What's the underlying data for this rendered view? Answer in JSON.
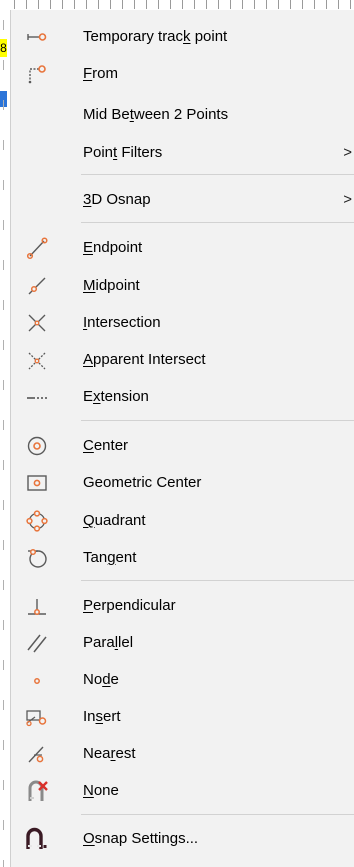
{
  "menu": {
    "items": [
      {
        "id": "temp-track",
        "pre": "Temporary trac",
        "mn": "k",
        "post": " point",
        "icon": "temporary-track-point-icon"
      },
      {
        "id": "from",
        "pre": "",
        "mn": "F",
        "post": "rom",
        "icon": "from-icon"
      },
      {
        "id": "mid-between",
        "pre": "Mid Be",
        "mn": "t",
        "post": "ween 2 Points",
        "icon": ""
      },
      {
        "id": "point-filters",
        "pre": "Poin",
        "mn": "t",
        "post": " Filters",
        "icon": "",
        "submenu": true
      },
      {
        "id": "3d-osnap",
        "pre": "",
        "mn": "3",
        "post": "D Osnap",
        "icon": "",
        "submenu": true
      },
      {
        "id": "endpoint",
        "pre": "",
        "mn": "E",
        "post": "ndpoint",
        "icon": "endpoint-icon"
      },
      {
        "id": "midpoint",
        "pre": "",
        "mn": "M",
        "post": "idpoint",
        "icon": "midpoint-icon"
      },
      {
        "id": "intersection",
        "pre": "",
        "mn": "I",
        "post": "ntersection",
        "icon": "intersection-icon"
      },
      {
        "id": "apparent-intersect",
        "pre": "",
        "mn": "A",
        "post": "pparent Intersect",
        "icon": "apparent-intersect-icon"
      },
      {
        "id": "extension",
        "pre": "E",
        "mn": "x",
        "post": "tension",
        "icon": "extension-icon"
      },
      {
        "id": "center",
        "pre": "",
        "mn": "C",
        "post": "enter",
        "icon": "center-icon"
      },
      {
        "id": "geometric-center",
        "pre": "Geometric Center",
        "mn": "",
        "post": "",
        "icon": "geometric-center-icon"
      },
      {
        "id": "quadrant",
        "pre": "",
        "mn": "Q",
        "post": "uadrant",
        "icon": "quadrant-icon"
      },
      {
        "id": "tangent",
        "pre": "Tan",
        "mn": "g",
        "post": "ent",
        "icon": "tangent-icon"
      },
      {
        "id": "perpendicular",
        "pre": "",
        "mn": "P",
        "post": "erpendicular",
        "icon": "perpendicular-icon"
      },
      {
        "id": "parallel",
        "pre": "Para",
        "mn": "l",
        "post": "lel",
        "icon": "parallel-icon"
      },
      {
        "id": "node",
        "pre": "No",
        "mn": "d",
        "post": "e",
        "icon": "node-icon"
      },
      {
        "id": "insert",
        "pre": "In",
        "mn": "s",
        "post": "ert",
        "icon": "insert-icon"
      },
      {
        "id": "nearest",
        "pre": "Nea",
        "mn": "r",
        "post": "est",
        "icon": "nearest-icon"
      },
      {
        "id": "none",
        "pre": "",
        "mn": "N",
        "post": "one",
        "icon": "none-icon"
      },
      {
        "id": "osnap-settings",
        "pre": "",
        "mn": "O",
        "post": "snap Settings...",
        "icon": "osnap-settings-icon"
      }
    ],
    "submenu_arrow": ">"
  },
  "edge": {
    "yellow_text": "8"
  },
  "colors": {
    "accent": "#e8743b",
    "icon_line": "#5a5a5a"
  }
}
